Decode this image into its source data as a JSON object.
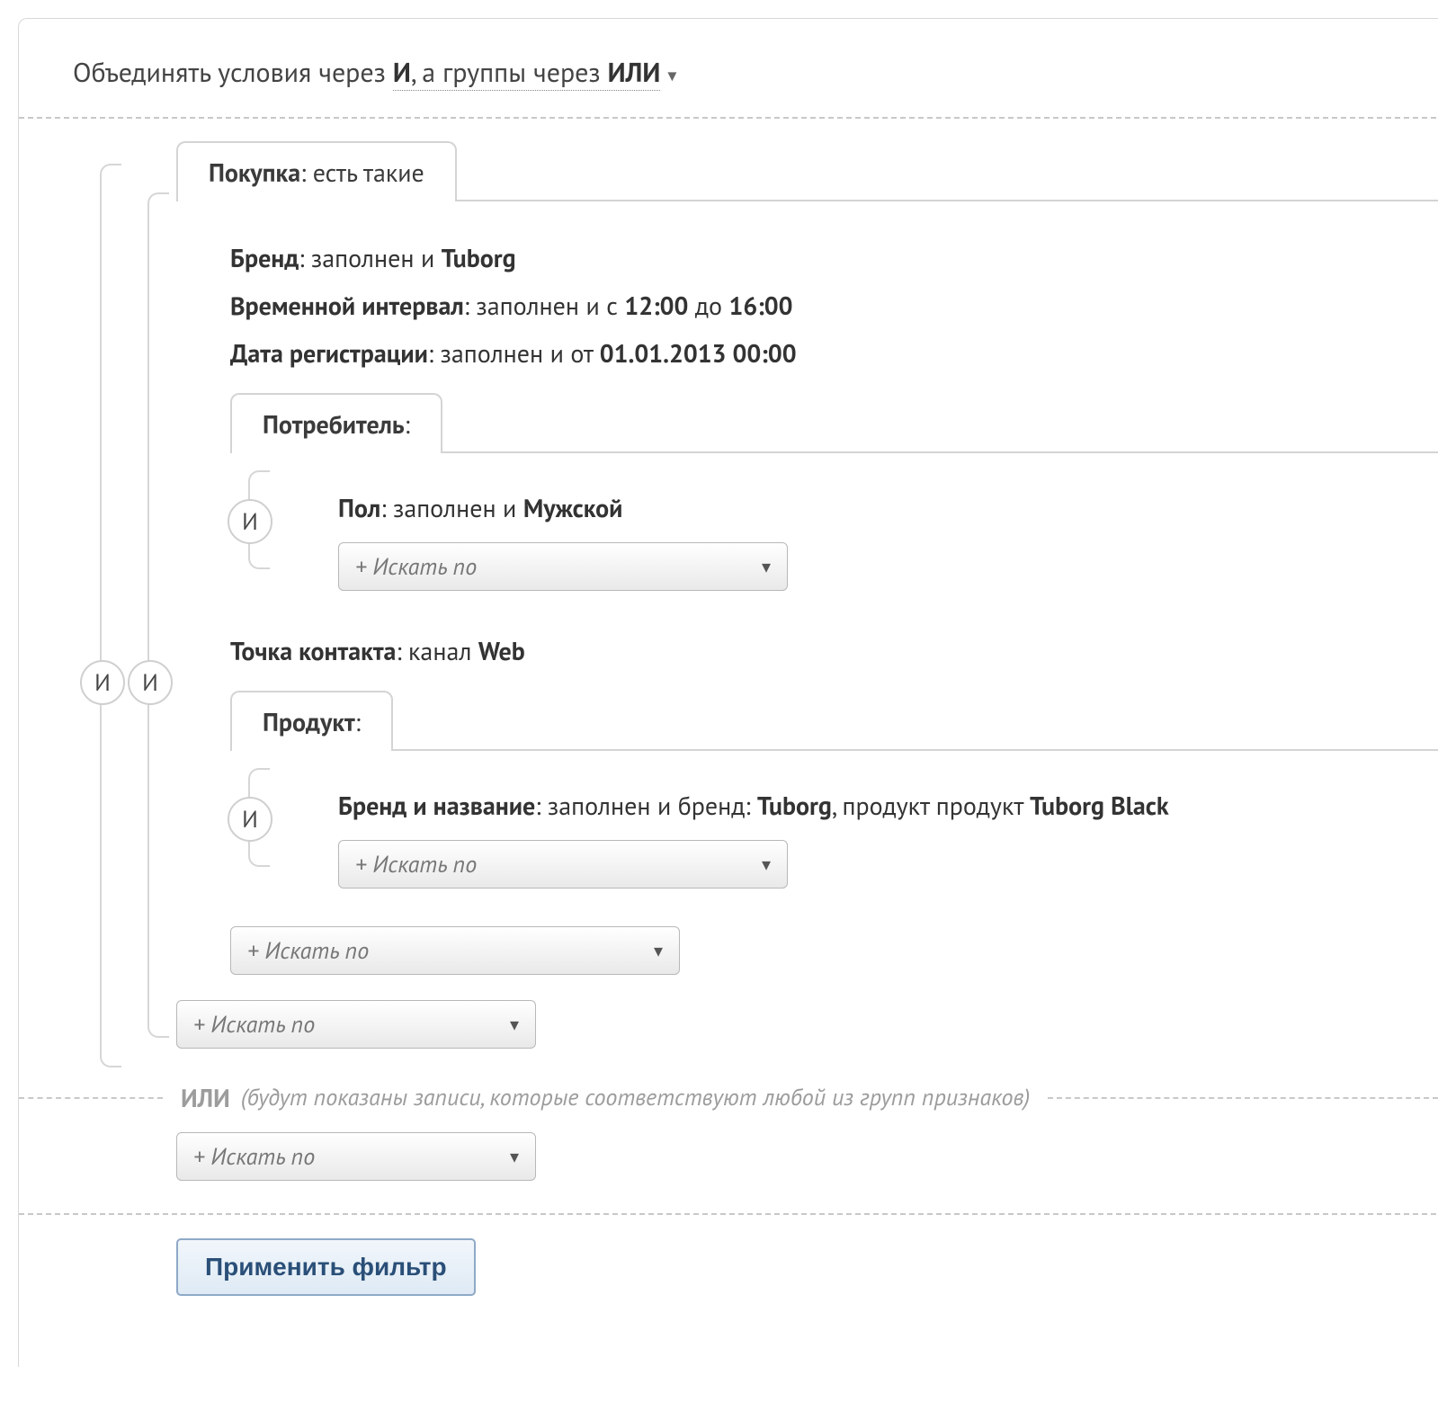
{
  "header": {
    "prefix": "Объединять условия через ",
    "and": "И",
    "middle": ", а группы через ",
    "or": "ИЛИ"
  },
  "op_and": "И",
  "purchase": {
    "title": "Покупка",
    "suffix": ": есть такие",
    "rule_brand": {
      "label": "Бренд",
      "middle": ": заполнен и ",
      "value": "Tuborg"
    },
    "rule_time": {
      "label": "Временной интервал",
      "pre": ": заполнен и с ",
      "from": "12:00",
      "mid": " до ",
      "to": "16:00"
    },
    "rule_regdate": {
      "label": "Дата регистрации",
      "pre": ": заполнен и от ",
      "value": "01.01.2013 00:00"
    },
    "rule_contact": {
      "label": "Точка контакта",
      "pre": ": канал ",
      "value": "Web"
    }
  },
  "consumer": {
    "title": "Потребитель",
    "suffix": ":",
    "rule_sex": {
      "label": "Пол",
      "pre": ": заполнен и ",
      "value": "Мужской"
    }
  },
  "product": {
    "title": "Продукт",
    "suffix": ":",
    "rule_brandname": {
      "label": "Бренд и название",
      "pre": ": заполнен и бренд: ",
      "brand": "Tuborg",
      "mid": ", продукт продукт ",
      "pname": "Tuborg Black"
    }
  },
  "search_label": "+ Искать по",
  "or_block": {
    "or": "ИЛИ",
    "note": "(будут показаны записи, которые соответствуют любой из групп признаков)"
  },
  "apply": "Применить фильтр"
}
